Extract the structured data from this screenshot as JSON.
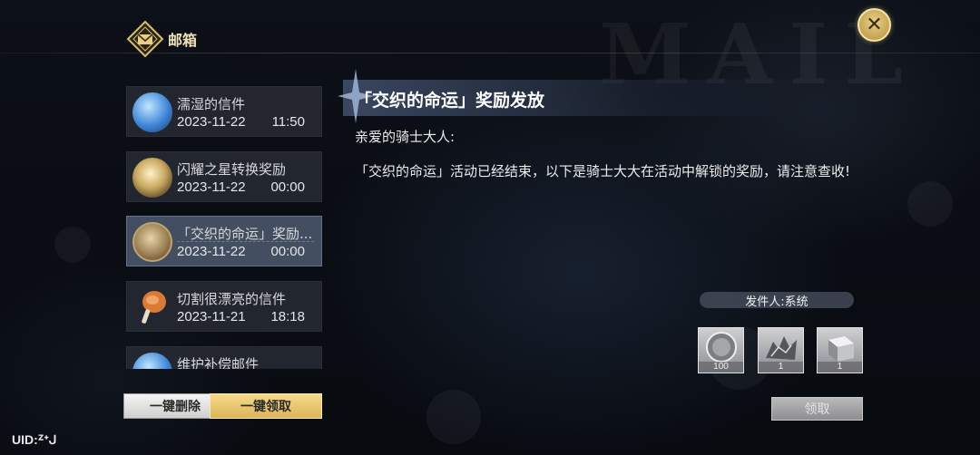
{
  "header": {
    "title": "邮箱",
    "emblem_icon": "mailbox-emblem-icon"
  },
  "close": {
    "label": "✕"
  },
  "mail_list": [
    {
      "subject": "濡湿的信件",
      "date": "2023-11-22",
      "time": "11:50",
      "icon": "blue-gem-icon",
      "selected": false
    },
    {
      "subject": "闪耀之星转换奖励",
      "date": "2023-11-22",
      "time": "00:00",
      "icon": "gold-coin-icon",
      "selected": false
    },
    {
      "subject": "「交织的命运」奖励...",
      "date": "2023-11-22",
      "time": "00:00",
      "icon": "bronze-medal-icon",
      "selected": true
    },
    {
      "subject": "切割很漂亮的信件",
      "date": "2023-11-21",
      "time": "18:18",
      "icon": "meat-drumstick-icon",
      "selected": false
    },
    {
      "subject": "维护补偿邮件",
      "date": "",
      "time": "",
      "icon": "blue-gem-icon",
      "selected": false
    }
  ],
  "buttons": {
    "delete_all": "一键删除",
    "claim_all": "一键领取",
    "claim": "领取"
  },
  "uid": "UID:ᙆᕀᒍ",
  "detail": {
    "title": "「交织的命运」奖励发放",
    "greeting": "亲爱的骑士大人:",
    "body": "「交织的命运」活动已经结束，以下是骑士大大在活动中解锁的奖励，请注意查收!",
    "sender": "发件人:系统"
  },
  "rewards": [
    {
      "count": "100",
      "icon": "medal-coin-icon"
    },
    {
      "count": "1",
      "icon": "dragon-figure-icon"
    },
    {
      "count": "1",
      "icon": "silver-cube-icon"
    }
  ],
  "colors": {
    "accent_gold": "#e9cf86",
    "selected_row": "#4e5a70",
    "claim_all_bg": "#f6d989"
  }
}
